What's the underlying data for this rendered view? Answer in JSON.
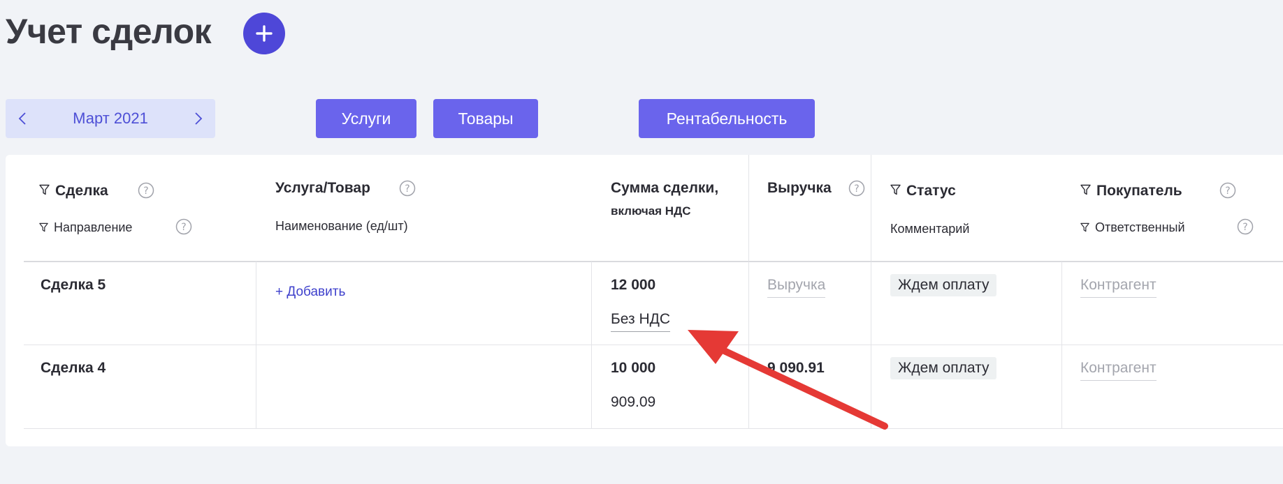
{
  "page": {
    "title": "Учет сделок"
  },
  "period": {
    "label": "Март 2021"
  },
  "tabs": {
    "services": "Услуги",
    "goods": "Товары",
    "profitability": "Рентабельность"
  },
  "table": {
    "headers": {
      "deal": "Сделка",
      "direction": "Направление",
      "product": "Услуга/Товар",
      "product_name": "Наименование (ед/шт)",
      "amount": "Сумма сделки,",
      "amount_sub": "включая НДС",
      "revenue": "Выручка",
      "status": "Статус",
      "comment": "Комментарий",
      "buyer": "Покупатель",
      "responsible": "Ответственный"
    },
    "rows": [
      {
        "deal": "Сделка 5",
        "product_action": "+ Добавить",
        "amount": "12 000",
        "vat": "Без НДС",
        "revenue_placeholder": "Выручка",
        "status": "Ждем оплату",
        "buyer_placeholder": "Контрагент"
      },
      {
        "deal": "Сделка 4",
        "amount": "10 000",
        "vat": "909.09",
        "revenue": "9 090.91",
        "status": "Ждем оплату",
        "buyer_placeholder": "Контрагент"
      }
    ]
  },
  "colors": {
    "accent": "#4e47d8",
    "tab": "#6a64ec",
    "period_bg": "#dde2fa",
    "arrow": "#e53935"
  }
}
